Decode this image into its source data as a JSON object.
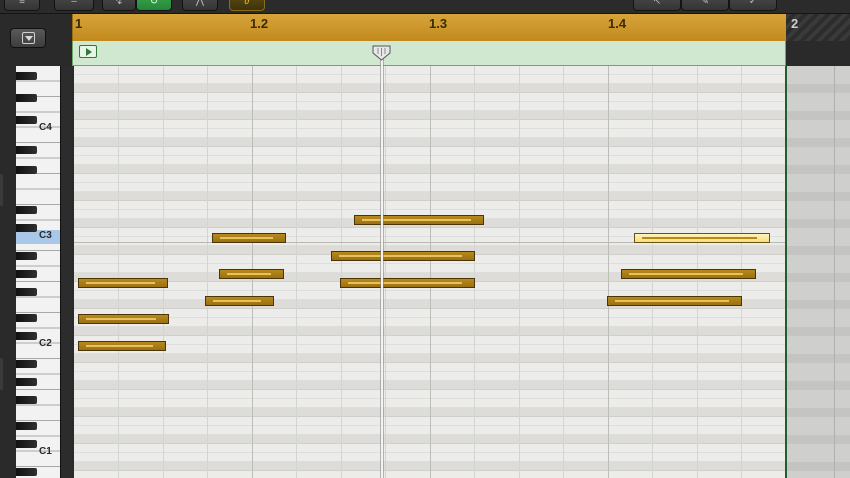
{
  "ruler": {
    "labels": [
      "1",
      "1.2",
      "1.3",
      "1.4",
      "2"
    ]
  },
  "keyboard": {
    "labels": [
      "C4",
      "C3",
      "C2",
      "C1"
    ],
    "highlighted_key": "C3"
  },
  "colors": {
    "ruler": "#c9951f",
    "region_header": "#cfe8cf",
    "note": "#a97b16",
    "note_selected": "#f8e7a0",
    "playhead": "#f3f3f3"
  },
  "icons": {
    "disclosure": "chevron-down-icon",
    "region": "play-icon",
    "playhead": "playhead-icon"
  }
}
